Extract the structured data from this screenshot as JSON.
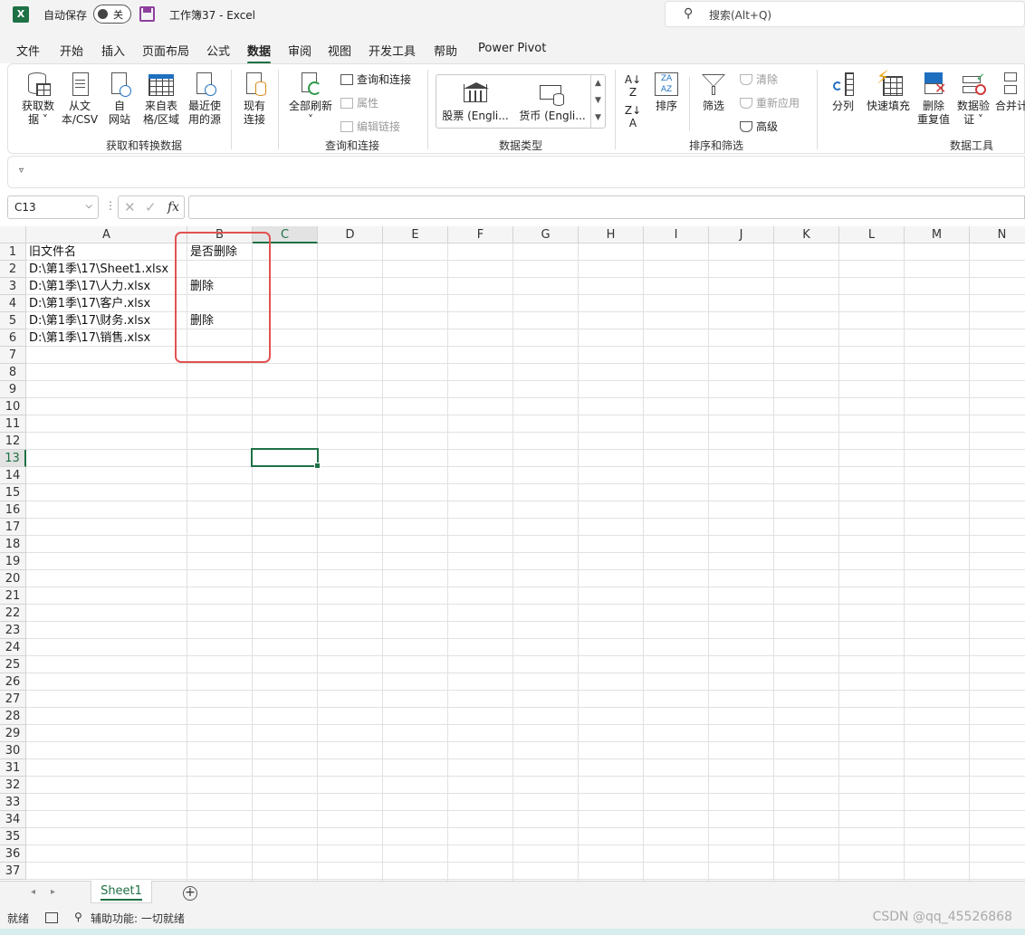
{
  "app": {
    "logo_letter": "X",
    "autosave_label": "自动保存",
    "autosave_state": "关",
    "document_title": "工作簿37  -  Excel",
    "search_placeholder": "搜索(Alt+Q)"
  },
  "menu_tabs": [
    "文件",
    "开始",
    "插入",
    "页面布局",
    "公式",
    "数据",
    "审阅",
    "视图",
    "开发工具",
    "帮助",
    "Power Pivot"
  ],
  "active_tab": "数据",
  "ribbon": {
    "get_data": {
      "get_data": "获取数\n据 ˅",
      "from_text": "从文\n本/CSV",
      "from_web": "自\n网站",
      "from_table": "来自表\n格/区域",
      "recent": "最近使\n用的源",
      "existing": "现有\n连接",
      "group_label": "获取和转换数据"
    },
    "queries": {
      "refresh_all": "全部刷新\n˅",
      "queries_connections": "查询和连接",
      "properties": "属性",
      "edit_links": "编辑链接",
      "group_label": "查询和连接"
    },
    "data_types": {
      "stocks": "股票 (Engli...",
      "currencies": "货币 (Engli...",
      "group_label": "数据类型"
    },
    "sort_filter": {
      "sort": "排序",
      "filter": "筛选",
      "clear": "清除",
      "reapply": "重新应用",
      "advanced": "高级",
      "group_label": "排序和筛选"
    },
    "data_tools": {
      "text_to_columns": "分列",
      "flash_fill": "快速填充",
      "remove_duplicates": "删除\n重复值",
      "data_validation": "数据验\n证 ˅",
      "consolidate": "合并计",
      "group_label": "数据工具"
    }
  },
  "formula_bar": {
    "name_box": "C13",
    "fx_label": "fx",
    "formula": ""
  },
  "columns": [
    "A",
    "B",
    "C",
    "D",
    "E",
    "F",
    "G",
    "H",
    "I",
    "J",
    "K",
    "L",
    "M",
    "N"
  ],
  "selected_column": "C",
  "rows": [
    "1",
    "2",
    "3",
    "4",
    "5",
    "6",
    "7",
    "8",
    "9",
    "10",
    "11",
    "12",
    "13",
    "14",
    "15",
    "16",
    "17",
    "18",
    "19",
    "20",
    "21",
    "22",
    "23",
    "24",
    "25",
    "26",
    "27",
    "28",
    "29",
    "30",
    "31",
    "32",
    "33",
    "34",
    "35",
    "36",
    "37"
  ],
  "selected_row": "13",
  "cells": {
    "A1": "旧文件名",
    "B1": "是否删除",
    "A2": "D:\\第1季\\17\\Sheet1.xlsx",
    "A3": "D:\\第1季\\17\\人力.xlsx",
    "B3": "删除",
    "A4": "D:\\第1季\\17\\客户.xlsx",
    "A5": "D:\\第1季\\17\\财务.xlsx",
    "B5": "删除",
    "A6": "D:\\第1季\\17\\销售.xlsx"
  },
  "sheet_tabs": [
    "Sheet1"
  ],
  "status": {
    "ready": "就绪",
    "accessibility": "辅助功能: 一切就绪",
    "watermark": "CSDN @qq_45526868"
  },
  "colors": {
    "excel_green": "#1e7145",
    "highlight_red": "#e25252"
  }
}
